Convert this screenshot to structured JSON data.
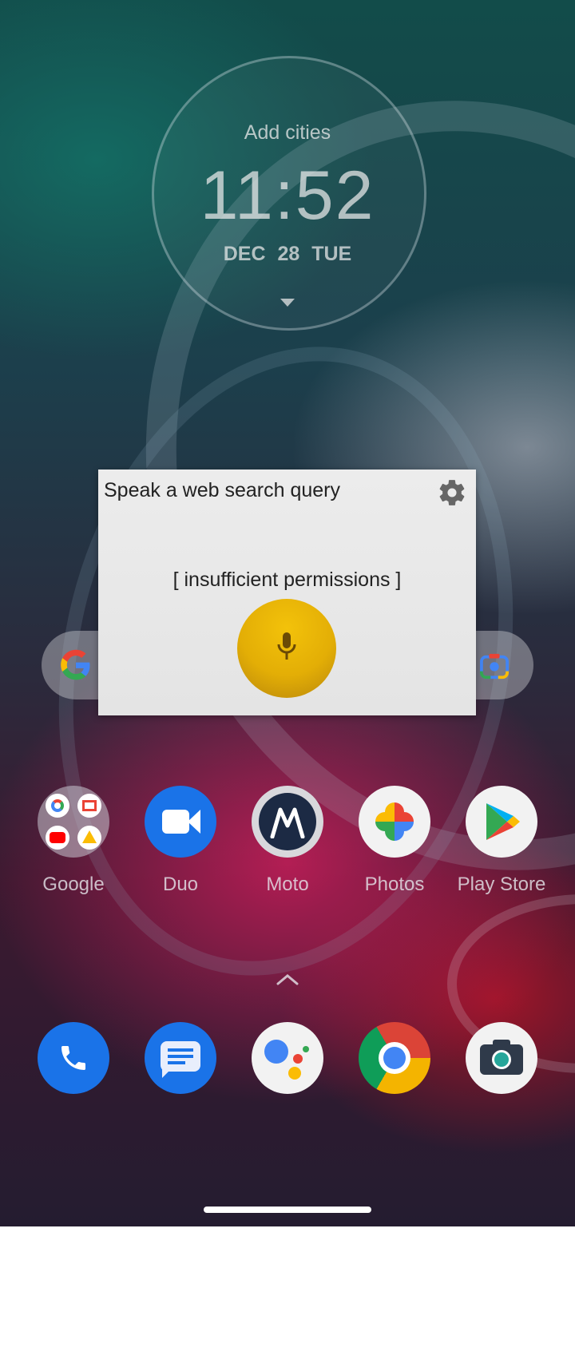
{
  "clock": {
    "add_cities": "Add cities",
    "time": "11:52",
    "date": "DEC  28  TUE"
  },
  "dialog": {
    "title": "Speak a web search query",
    "status": "[ insufficient permissions ]",
    "accent_color": "#e3ae06"
  },
  "home": {
    "apps": [
      {
        "label": "Google",
        "icon": "google-folder-icon"
      },
      {
        "label": "Duo",
        "icon": "duo-icon"
      },
      {
        "label": "Moto",
        "icon": "moto-icon"
      },
      {
        "label": "Photos",
        "icon": "photos-icon"
      },
      {
        "label": "Play Store",
        "icon": "play-store-icon"
      }
    ],
    "dock": [
      {
        "icon": "phone-icon"
      },
      {
        "icon": "messages-icon"
      },
      {
        "icon": "assistant-icon"
      },
      {
        "icon": "chrome-icon"
      },
      {
        "icon": "camera-icon"
      }
    ]
  }
}
